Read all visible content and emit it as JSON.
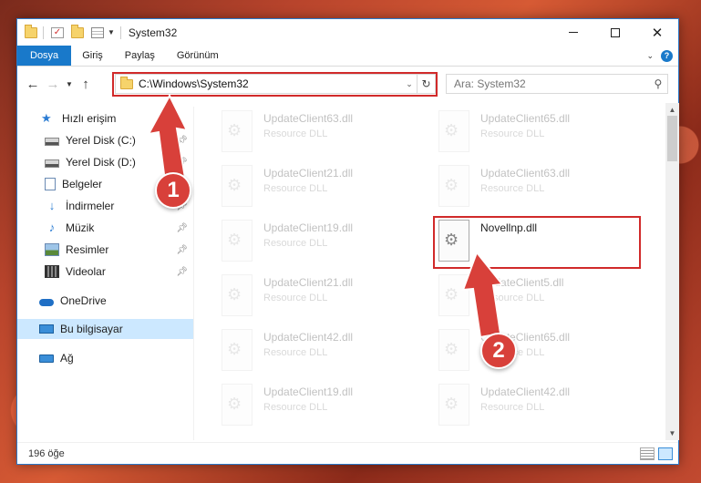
{
  "window": {
    "title": "System32"
  },
  "ribbon": {
    "tabs": [
      "Dosya",
      "Giriş",
      "Paylaş",
      "Görünüm"
    ]
  },
  "address": {
    "path": "C:\\Windows\\System32"
  },
  "search": {
    "placeholder": "Ara: System32"
  },
  "navpane": {
    "quick_access": "Hızlı erişim",
    "items": [
      {
        "label": "Yerel Disk (C:)",
        "icon": "drive-icon",
        "pinned": true
      },
      {
        "label": "Yerel Disk (D:)",
        "icon": "drive-icon",
        "pinned": true
      },
      {
        "label": "Belgeler",
        "icon": "documents-icon",
        "pinned": true
      },
      {
        "label": "İndirmeler",
        "icon": "downloads-icon",
        "pinned": true
      },
      {
        "label": "Müzik",
        "icon": "music-icon",
        "pinned": true
      },
      {
        "label": "Resimler",
        "icon": "pictures-icon",
        "pinned": true
      },
      {
        "label": "Videolar",
        "icon": "videos-icon",
        "pinned": true
      }
    ],
    "onedrive": "OneDrive",
    "this_pc": "Bu bilgisayar",
    "network": "Ağ"
  },
  "files": {
    "left": [
      {
        "name": "UpdateClient63.dll",
        "type": "Resource DLL"
      },
      {
        "name": "UpdateClient21.dll",
        "type": "Resource DLL"
      },
      {
        "name": "UpdateClient19.dll",
        "type": "Resource DLL"
      },
      {
        "name": "UpdateClient21.dll",
        "type": "Resource DLL"
      },
      {
        "name": "UpdateClient42.dll",
        "type": "Resource DLL"
      },
      {
        "name": "UpdateClient19.dll",
        "type": "Resource DLL"
      }
    ],
    "right": [
      {
        "name": "UpdateClient65.dll",
        "type": "Resource DLL"
      },
      {
        "name": "UpdateClient63.dll",
        "type": "Resource DLL"
      },
      {
        "name": "Novellnp.dll",
        "type": ""
      },
      {
        "name": "UpdateClient5.dll",
        "type": "Resource DLL"
      },
      {
        "name": "UpdateClient65.dll",
        "type": "Resource DLL"
      },
      {
        "name": "UpdateClient42.dll",
        "type": "Resource DLL"
      }
    ]
  },
  "status": {
    "count_text": "196 öğe"
  },
  "annotations": {
    "badge1": "1",
    "badge2": "2",
    "color": "#d8403a"
  },
  "colors": {
    "accent": "#1979ca",
    "highlight": "#d12a2a",
    "selected": "#cce8ff"
  }
}
